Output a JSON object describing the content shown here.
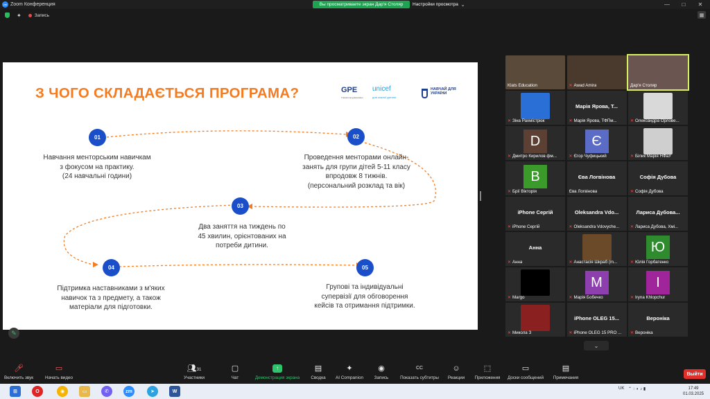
{
  "window": {
    "title": "Zoom Конференция",
    "share_banner": "Вы просматриваете экран Дар'я Столяр",
    "view_options": "Настройки просмотра",
    "minimize": "—",
    "maximize": "□",
    "close": "✕",
    "record_label": "Запись"
  },
  "slide": {
    "title": "З ЧОГО СКЛАДАЄТЬСЯ ПРОГРАМА?",
    "logos": {
      "gpe": "GPE",
      "gpe_sub": "Transforming Education",
      "unicef": "unicef",
      "unicef_sub": "для кожної дитини",
      "nu": "НАВЧАЙ ДЛЯ УКРАЇНИ"
    },
    "steps": [
      {
        "num": "01",
        "lines": [
          "Навчання менторським навичкам",
          "з фокусом на практику.",
          "(24 навчальні години)"
        ]
      },
      {
        "num": "02",
        "lines": [
          "Проведення менторами онлайн-",
          "занять для групи дітей 5-11 класу",
          "впродовж 8 тижнів.",
          "(персональний розклад та вік)"
        ]
      },
      {
        "num": "03",
        "lines": [
          "Два заняття на тиждень по",
          "45 хвилин, орієнтованих на",
          "потреби дитини."
        ]
      },
      {
        "num": "04",
        "lines": [
          "Підтримка наставниками з м'яких",
          "навичок та з предмету, а також",
          "матеріали для підготовки."
        ]
      },
      {
        "num": "05",
        "lines": [
          "Групові та індивідуальні",
          "супервізії для обговорення",
          "кейсів та отримання підтримки."
        ]
      }
    ]
  },
  "participants": [
    {
      "label": "Klats Education",
      "big": "",
      "letter": "",
      "color": "#5a4a3a",
      "muted": false
    },
    {
      "label": "Awad Amira",
      "big": "",
      "letter": "",
      "color": "#4a3a2e",
      "muted": true
    },
    {
      "label": "Дар'я Столяр",
      "big": "",
      "letter": "",
      "color": "#6a5550",
      "muted": false
    },
    {
      "label": "Зіна Рахмістрюк",
      "big": "",
      "letter": "",
      "color": "#2a6fd6",
      "muted": true
    },
    {
      "label": "Марія Ярова, ТФПм...",
      "big": "Марія Ярова, Т...",
      "letter": "",
      "color": "",
      "muted": true
    },
    {
      "label": "Олександра Орлове...",
      "big": "",
      "letter": "",
      "color": "#d9d9d9",
      "muted": true
    },
    {
      "label": "Дмитро Кирилов фм...",
      "big": "",
      "letter": "D",
      "color": "#5c4033",
      "muted": true
    },
    {
      "label": "Єгор Чуфицький",
      "big": "",
      "letter": "Є",
      "color": "#5b6cc7",
      "muted": true
    },
    {
      "label": "Білик Марія НФаУ",
      "big": "",
      "letter": "",
      "color": "#cfcfcf",
      "muted": true
    },
    {
      "label": "Брії Вікторія",
      "big": "",
      "letter": "В",
      "color": "#3a9a2a",
      "muted": true
    },
    {
      "label": "Єва Логвінова",
      "big": "Єва Логвінова",
      "letter": "",
      "color": "",
      "muted": false
    },
    {
      "label": "Софія Дубова",
      "big": "Софія Дубова",
      "letter": "",
      "color": "",
      "muted": true
    },
    {
      "label": "iPhone Сергій",
      "big": "iPhone Сергій",
      "letter": "",
      "color": "",
      "muted": true
    },
    {
      "label": "Oleksandra Vdovyche...",
      "big": "Oleksandra Vdo...",
      "letter": "",
      "color": "",
      "muted": true
    },
    {
      "label": "Лариса Дубова, Хмі...",
      "big": "Лариса Дубова...",
      "letter": "",
      "color": "",
      "muted": true
    },
    {
      "label": "Анна",
      "big": "Анна",
      "letter": "",
      "color": "",
      "muted": true
    },
    {
      "label": "Анастасія Шкраб (m...",
      "big": "",
      "letter": "",
      "color": "#6b4a2a",
      "muted": true
    },
    {
      "label": "Юлія Горбатенко",
      "big": "",
      "letter": "Ю",
      "color": "#2e8b2e",
      "muted": true
    },
    {
      "label": "Margo",
      "big": "",
      "letter": "",
      "color": "#000000",
      "muted": true
    },
    {
      "label": "Марія Бобечко",
      "big": "",
      "letter": "М",
      "color": "#8e3fae",
      "muted": true
    },
    {
      "label": "Iryna Khlopchur",
      "big": "",
      "letter": "І",
      "color": "#a1259a",
      "muted": true
    },
    {
      "label": "Микола З",
      "big": "",
      "letter": "",
      "color": "#8a2020",
      "muted": true
    },
    {
      "label": "iPhone OLEG 15 PRO ...",
      "big": "iPhone OLEG 15...",
      "letter": "",
      "color": "",
      "muted": true
    },
    {
      "label": "Вероніка",
      "big": "Вероніка",
      "letter": "",
      "color": "",
      "muted": true
    }
  ],
  "toolbar": {
    "audio": "Включить звук",
    "video": "Начать видео",
    "participants": "Участники",
    "participants_count": "31",
    "chat": "Чат",
    "share": "Демонстрация экрана",
    "notes": "Сводка",
    "companion": "AI Companion",
    "record": "Запись",
    "captions": "Показать субтитры",
    "reactions": "Реакции",
    "apps": "Приложения",
    "whiteboard": "Доски сообщений",
    "notes2": "Примечания",
    "leave": "Выйти"
  },
  "taskbar": {
    "lang": "UK",
    "time": "17:49",
    "date": "01.03.2025"
  }
}
